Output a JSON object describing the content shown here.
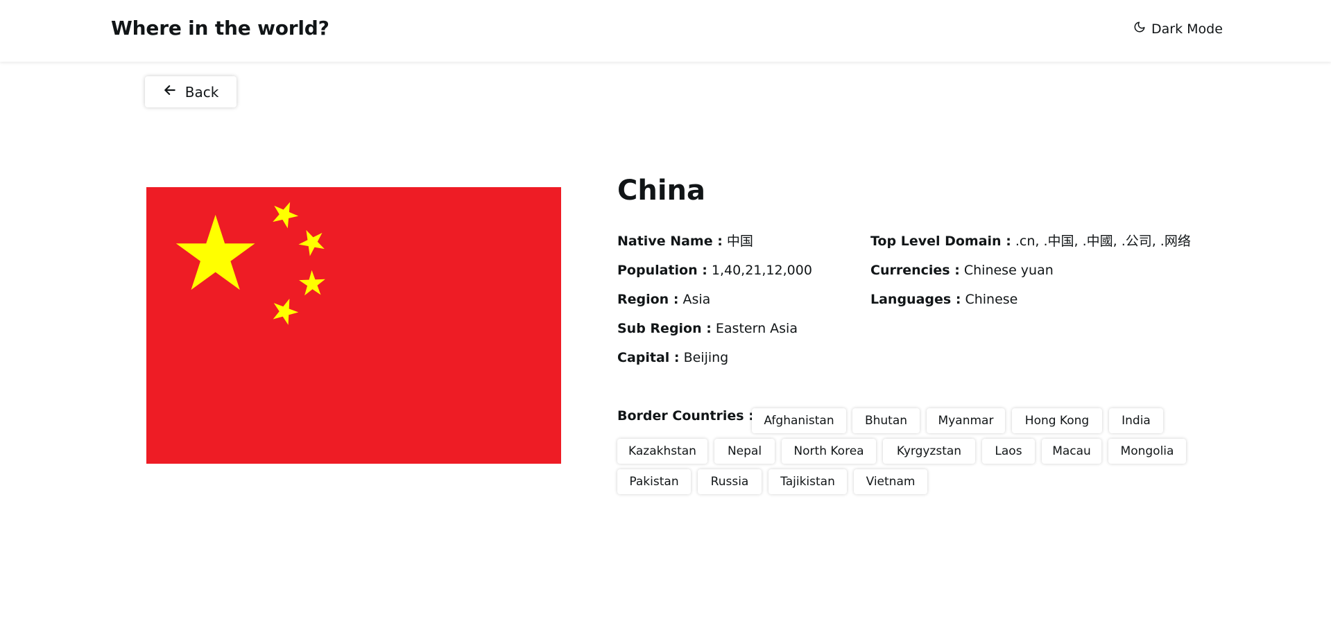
{
  "header": {
    "title": "Where in the world?",
    "dark_mode_label": "Dark Mode",
    "dark_mode_icon": "moon-icon"
  },
  "back_button": {
    "label": "Back",
    "icon": "arrow-left-icon"
  },
  "flag": {
    "icon": "china-flag",
    "colors": {
      "field": "#EE1C25",
      "stars": "#FFFF00"
    }
  },
  "country": {
    "name": "China",
    "details_left": [
      {
        "label": "Native Name :",
        "value": "中国"
      },
      {
        "label": "Population :",
        "value": "1,40,21,12,000"
      },
      {
        "label": "Region :",
        "value": "Asia"
      },
      {
        "label": "Sub Region :",
        "value": "Eastern Asia"
      },
      {
        "label": "Capital :",
        "value": "Beijing"
      }
    ],
    "details_right": [
      {
        "label": "Top Level Domain :",
        "value": ".cn, .中国, .中國, .公司, .网络"
      },
      {
        "label": "Currencies :",
        "value": "Chinese yuan"
      },
      {
        "label": "Languages :",
        "value": "Chinese"
      }
    ],
    "border_label": "Border Countries :",
    "border_countries": [
      "Afghanistan",
      "Bhutan",
      "Myanmar",
      "Hong Kong",
      "India",
      "Kazakhstan",
      "Nepal",
      "North Korea",
      "Kyrgyzstan",
      "Laos",
      "Macau",
      "Mongolia",
      "Pakistan",
      "Russia",
      "Tajikistan",
      "Vietnam"
    ]
  }
}
